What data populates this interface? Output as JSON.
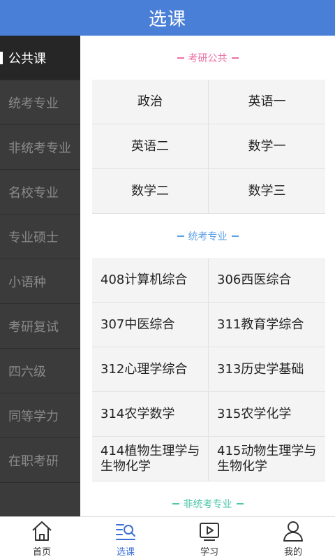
{
  "header": {
    "title": "选课"
  },
  "sidebar": {
    "items": [
      {
        "label": "公共课",
        "active": true
      },
      {
        "label": "统考专业"
      },
      {
        "label": "非统考专业"
      },
      {
        "label": "名校专业"
      },
      {
        "label": "专业硕士"
      },
      {
        "label": "小语种"
      },
      {
        "label": "考研复试"
      },
      {
        "label": "四六级"
      },
      {
        "label": "同等学力"
      },
      {
        "label": "在职考研"
      }
    ]
  },
  "sections": [
    {
      "title": "考研公共",
      "color": "#ec6fa3",
      "courses": [
        "政治",
        "英语一",
        "英语二",
        "数学一",
        "数学二",
        "数学三"
      ]
    },
    {
      "title": "统考专业",
      "color": "#5aa0e6",
      "courses": [
        "408计算机综合",
        "306西医综合",
        "307中医综合",
        "311教育学综合",
        "312心理学综合",
        "313历史学基础",
        "314农学数学",
        "315农学化学",
        "414植物生理学与生物化学",
        "415动物生理学与生物化学"
      ]
    },
    {
      "title": "非统考专业",
      "color": "#4bc6a9"
    }
  ],
  "tabbar": {
    "items": [
      {
        "label": "首页",
        "icon": "home-icon"
      },
      {
        "label": "选课",
        "icon": "course-search-icon",
        "active": true
      },
      {
        "label": "学习",
        "icon": "play-video-icon"
      },
      {
        "label": "我的",
        "icon": "user-icon"
      }
    ]
  }
}
